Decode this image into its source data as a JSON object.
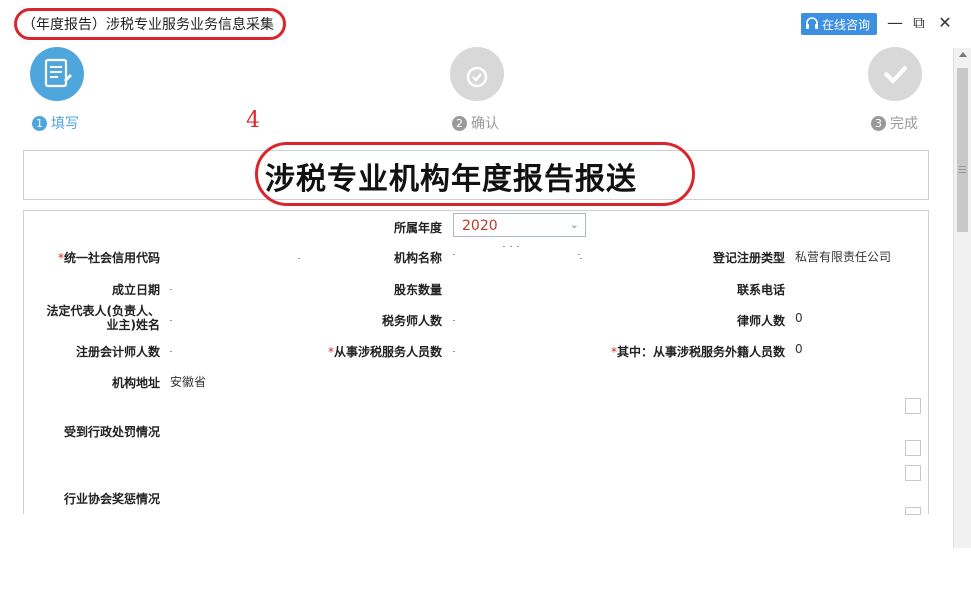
{
  "window": {
    "title": "（年度报告）涉税专业服务业务信息采集",
    "consult_label": "在线咨询",
    "minimize": "—",
    "maximize": "⧉",
    "close": "✕"
  },
  "steps": [
    {
      "num": "1",
      "label": "填写",
      "active": true
    },
    {
      "num": "2",
      "label": "确认",
      "active": false
    },
    {
      "num": "3",
      "label": "完成",
      "active": false
    }
  ],
  "annotation_number": "4",
  "heading": "涉税专业机构年度报告报送",
  "form": {
    "year_label": "所属年度",
    "year_value": "2020",
    "credit_code_label": "统一社会信用代码",
    "org_name_label": "机构名称",
    "reg_type_label": "登记注册类型",
    "reg_type_value": "私营有限责任公司",
    "founded_label": "成立日期",
    "shareholders_label": "股东数量",
    "phone_label": "联系电话",
    "legal_rep_label_1": "法定代表人(负责人、",
    "legal_rep_label_2": "业主)姓名",
    "tax_agents_label": "税务师人数",
    "lawyers_label": "律师人数",
    "lawyers_value": "0",
    "accountants_label": "注册会计师人数",
    "staff_label": "从事涉税服务人员数",
    "foreign_staff_label": "其中：从事涉税服务外籍人员数",
    "foreign_staff_value": "0",
    "address_label": "机构地址",
    "address_value": "安徽省",
    "penalty_label": "受到行政处罚情况",
    "award_label": "行业协会奖惩情况"
  },
  "colors": {
    "accent": "#4fa6dc",
    "annotation_red": "#d9252c",
    "consult_blue": "#3d8fe0"
  }
}
